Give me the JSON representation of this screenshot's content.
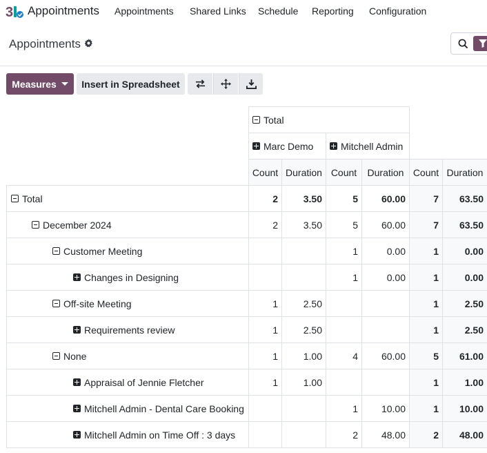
{
  "navbar": {
    "app_name": "Appointments",
    "menu": [
      "Appointments",
      "Shared Links",
      "Schedule",
      "Reporting",
      "Configuration"
    ]
  },
  "control_panel": {
    "title": "Appointments"
  },
  "toolbar": {
    "measures_label": "Measures",
    "insert_label": "Insert in Spreadsheet",
    "icons": [
      "flip-axis-icon",
      "expand-all-icon",
      "download-icon"
    ]
  },
  "pivot": {
    "col_total_header": "Total",
    "col_groups": [
      "Marc Demo",
      "Mitchell Admin"
    ],
    "measure_headers": [
      "Count",
      "Duration",
      "Count",
      "Duration",
      "Count",
      "Duration"
    ],
    "rows": [
      {
        "label": "Total",
        "level": 0,
        "toggle": "minus",
        "values": [
          "2",
          "3.50",
          "5",
          "60.00",
          "7",
          "63.50"
        ],
        "bold": true
      },
      {
        "label": "December 2024",
        "level": 1,
        "toggle": "minus",
        "values": [
          "2",
          "3.50",
          "5",
          "60.00",
          "7",
          "63.50"
        ]
      },
      {
        "label": "Customer Meeting",
        "level": 2,
        "toggle": "minus",
        "values": [
          "",
          "",
          "1",
          "0.00",
          "1",
          "0.00"
        ]
      },
      {
        "label": "Changes in Designing",
        "level": 3,
        "toggle": "plus",
        "values": [
          "",
          "",
          "1",
          "0.00",
          "1",
          "0.00"
        ]
      },
      {
        "label": "Off-site Meeting",
        "level": 2,
        "toggle": "minus",
        "values": [
          "1",
          "2.50",
          "",
          "",
          "1",
          "2.50"
        ]
      },
      {
        "label": "Requirements review",
        "level": 3,
        "toggle": "plus",
        "values": [
          "1",
          "2.50",
          "",
          "",
          "1",
          "2.50"
        ]
      },
      {
        "label": "None",
        "level": 2,
        "toggle": "minus",
        "values": [
          "1",
          "1.00",
          "4",
          "60.00",
          "5",
          "61.00"
        ]
      },
      {
        "label": "Appraisal of Jennie Fletcher",
        "level": 3,
        "toggle": "plus",
        "values": [
          "1",
          "1.00",
          "",
          "",
          "1",
          "1.00"
        ]
      },
      {
        "label": "Mitchell Admin - Dental Care Booking",
        "level": 3,
        "toggle": "plus",
        "values": [
          "",
          "",
          "1",
          "10.00",
          "1",
          "10.00"
        ]
      },
      {
        "label": "Mitchell Admin on Time Off : 3 days",
        "level": 3,
        "toggle": "plus",
        "values": [
          "",
          "",
          "2",
          "48.00",
          "2",
          "48.00"
        ]
      }
    ]
  }
}
